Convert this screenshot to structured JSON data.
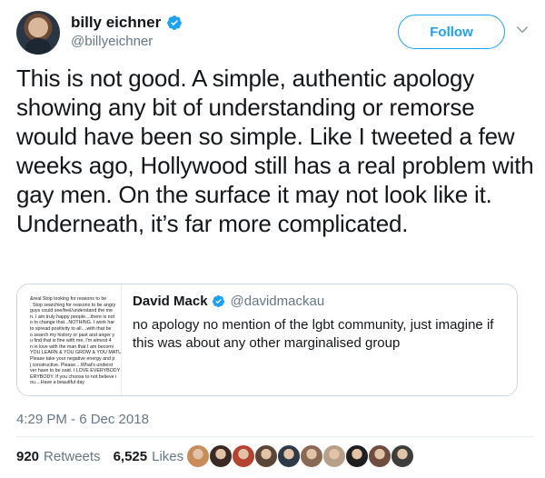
{
  "author": {
    "display_name": "billy eichner",
    "handle": "@billyeichner",
    "avatar_icon": "avatar-billy-eichner",
    "verified": true
  },
  "actions": {
    "follow_label": "Follow",
    "more_icon": "chevron-down-icon"
  },
  "tweet": {
    "text": "This is not good. A simple, authentic apology showing any bit of understanding or remorse would have been so simple. Like I tweeted a few weeks ago, Hollywood still has a real problem with gay men. On the surface it may not look like it. Underneath, it’s far more complicated.",
    "timestamp": "4:29 PM - 6 Dec 2018"
  },
  "quoted_tweet": {
    "display_name": "David Mack",
    "handle": "@davidmackau",
    "verified": true,
    "text": "no apology no mention of the lgbt community, just imagine if this was about any other marginalised group",
    "thumbnail_lines": [
      "&real Stop looking for reasons to be",
      ". Stop searching for reasons to be angry",
      "guys could see/feel/understand the me",
      "n. I am truly happy people....there is not",
      "o to change that...NOTHING. I work har",
      "to spread positivity to all....with that be",
      "o search my history or past and anger y",
      "u find that is fine with me, I'm almost 4",
      "n in love with the man that I am becomi",
      "YOU LEARN & YOU GROW & YOU MATU",
      "Please take your negative energy and p",
      "j constructive. Please....What's underst",
      "ver have to be said. I LOVE EVERYBODY",
      "ERYBODY. If you choose to not believe i",
      "ou....Have a beautiful day"
    ]
  },
  "stats": {
    "retweets_count": "920",
    "retweets_label": "Retweets",
    "likes_count": "6,525",
    "likes_label": "Likes"
  },
  "colors": {
    "accent": "#1da1f2",
    "secondary_text": "#657786",
    "border": "#ccd6dd"
  },
  "likers": [
    {
      "icon": "liker-avatar-1",
      "color": "#c98d5b"
    },
    {
      "icon": "liker-avatar-2",
      "color": "#3b2a24"
    },
    {
      "icon": "liker-avatar-3",
      "color": "#b4442f"
    },
    {
      "icon": "liker-avatar-4",
      "color": "#5a4638"
    },
    {
      "icon": "liker-avatar-5",
      "color": "#2f3a48"
    },
    {
      "icon": "liker-avatar-6",
      "color": "#8a6a56"
    },
    {
      "icon": "liker-avatar-7",
      "color": "#b7a08a"
    },
    {
      "icon": "liker-avatar-8",
      "color": "#1f1f1f"
    },
    {
      "icon": "liker-avatar-9",
      "color": "#6e4d3e"
    },
    {
      "icon": "liker-avatar-10",
      "color": "#3d3d3d"
    }
  ]
}
